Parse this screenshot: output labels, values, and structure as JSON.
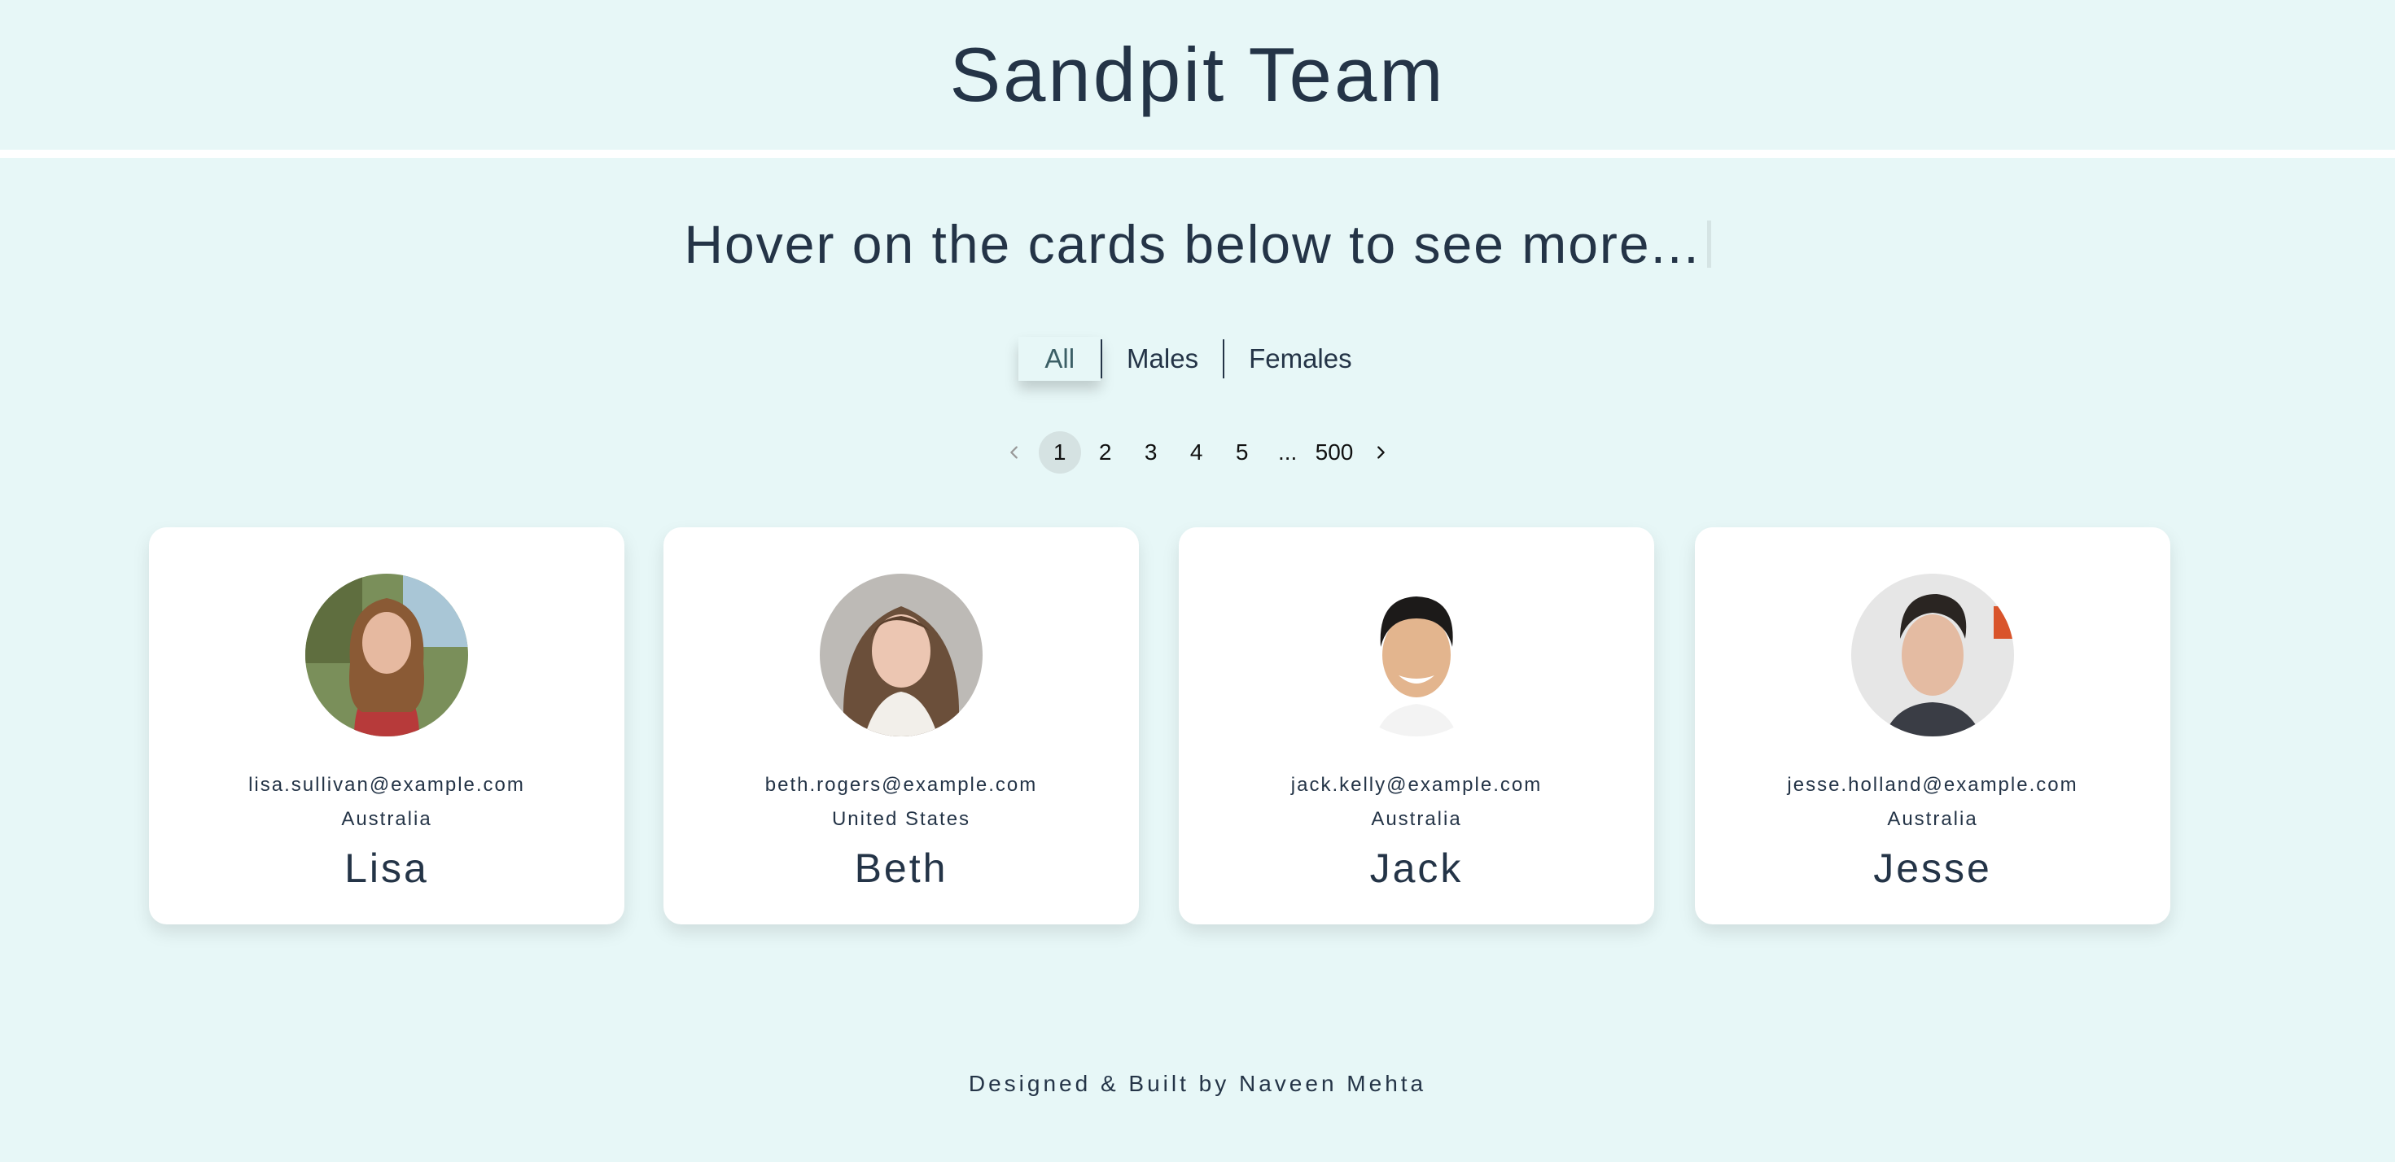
{
  "header": {
    "title": "Sandpit Team"
  },
  "subtitle": "Hover on the cards below to see more...",
  "filters": [
    {
      "label": "All",
      "active": true
    },
    {
      "label": "Males",
      "active": false
    },
    {
      "label": "Females",
      "active": false
    }
  ],
  "pagination": {
    "prev_icon": "chevron-left-icon",
    "next_icon": "chevron-right-icon",
    "pages": [
      "1",
      "2",
      "3",
      "4",
      "5",
      "...",
      "500"
    ],
    "current": "1"
  },
  "cards": [
    {
      "email": "lisa.sullivan@example.com",
      "country": "Australia",
      "name": "Lisa",
      "avatar": "profile-photo-icon"
    },
    {
      "email": "beth.rogers@example.com",
      "country": "United States",
      "name": "Beth",
      "avatar": "profile-photo-icon"
    },
    {
      "email": "jack.kelly@example.com",
      "country": "Australia",
      "name": "Jack",
      "avatar": "profile-photo-icon"
    },
    {
      "email": "jesse.holland@example.com",
      "country": "Australia",
      "name": "Jesse",
      "avatar": "profile-photo-icon"
    }
  ],
  "footer": {
    "credit": "Designed & Built by Naveen Mehta"
  },
  "colors": {
    "background": "#e7f7f7",
    "text": "#243447",
    "card": "#ffffff",
    "active_page": "#d5e2e2"
  }
}
